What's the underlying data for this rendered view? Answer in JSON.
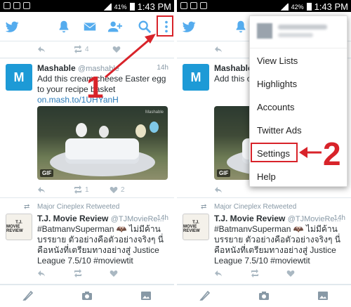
{
  "status_left": {
    "time": "1:43 PM",
    "battery": "41%"
  },
  "status_right": {
    "time": "1:43 PM",
    "battery": "42%"
  },
  "tweets": [
    {
      "name": "Mashable",
      "handle": "@mashable",
      "time": "14h",
      "avatar_letter": "M",
      "text": "Add this cream cheese Easter egg to your recipe basket",
      "link": "on.mash.to/1UHYanH",
      "media_badge": "GIF",
      "media_watermark": "Mashable",
      "retweets": "1",
      "likes": "2"
    },
    {
      "retweeted_by": "Major Cineplex Retweeted",
      "name": "T.J. Movie Review",
      "handle": "@TJMovieRe...",
      "time": "14h",
      "avatar_text_1": "T.J.",
      "avatar_text_2": "MOVIE REVIEW",
      "text": "#BatmanvSuperman 🦇 ไม่มีค้านบรรยาย ตัวอย่างคือตัวอย่างจริงๆ นี่คือหนังที่เตรียมทางอย่างสู่ Justice League 7.5/10 #moviewtit"
    }
  ],
  "top_counts": {
    "retweets": "4"
  },
  "menu": {
    "items": [
      "View Lists",
      "Highlights",
      "Accounts",
      "Twitter Ads",
      "Settings",
      "Help"
    ]
  },
  "annotations": {
    "step1": "1",
    "step2": "2"
  },
  "colors": {
    "twitter_blue": "#55acee",
    "annotation_red": "#d8232a"
  }
}
